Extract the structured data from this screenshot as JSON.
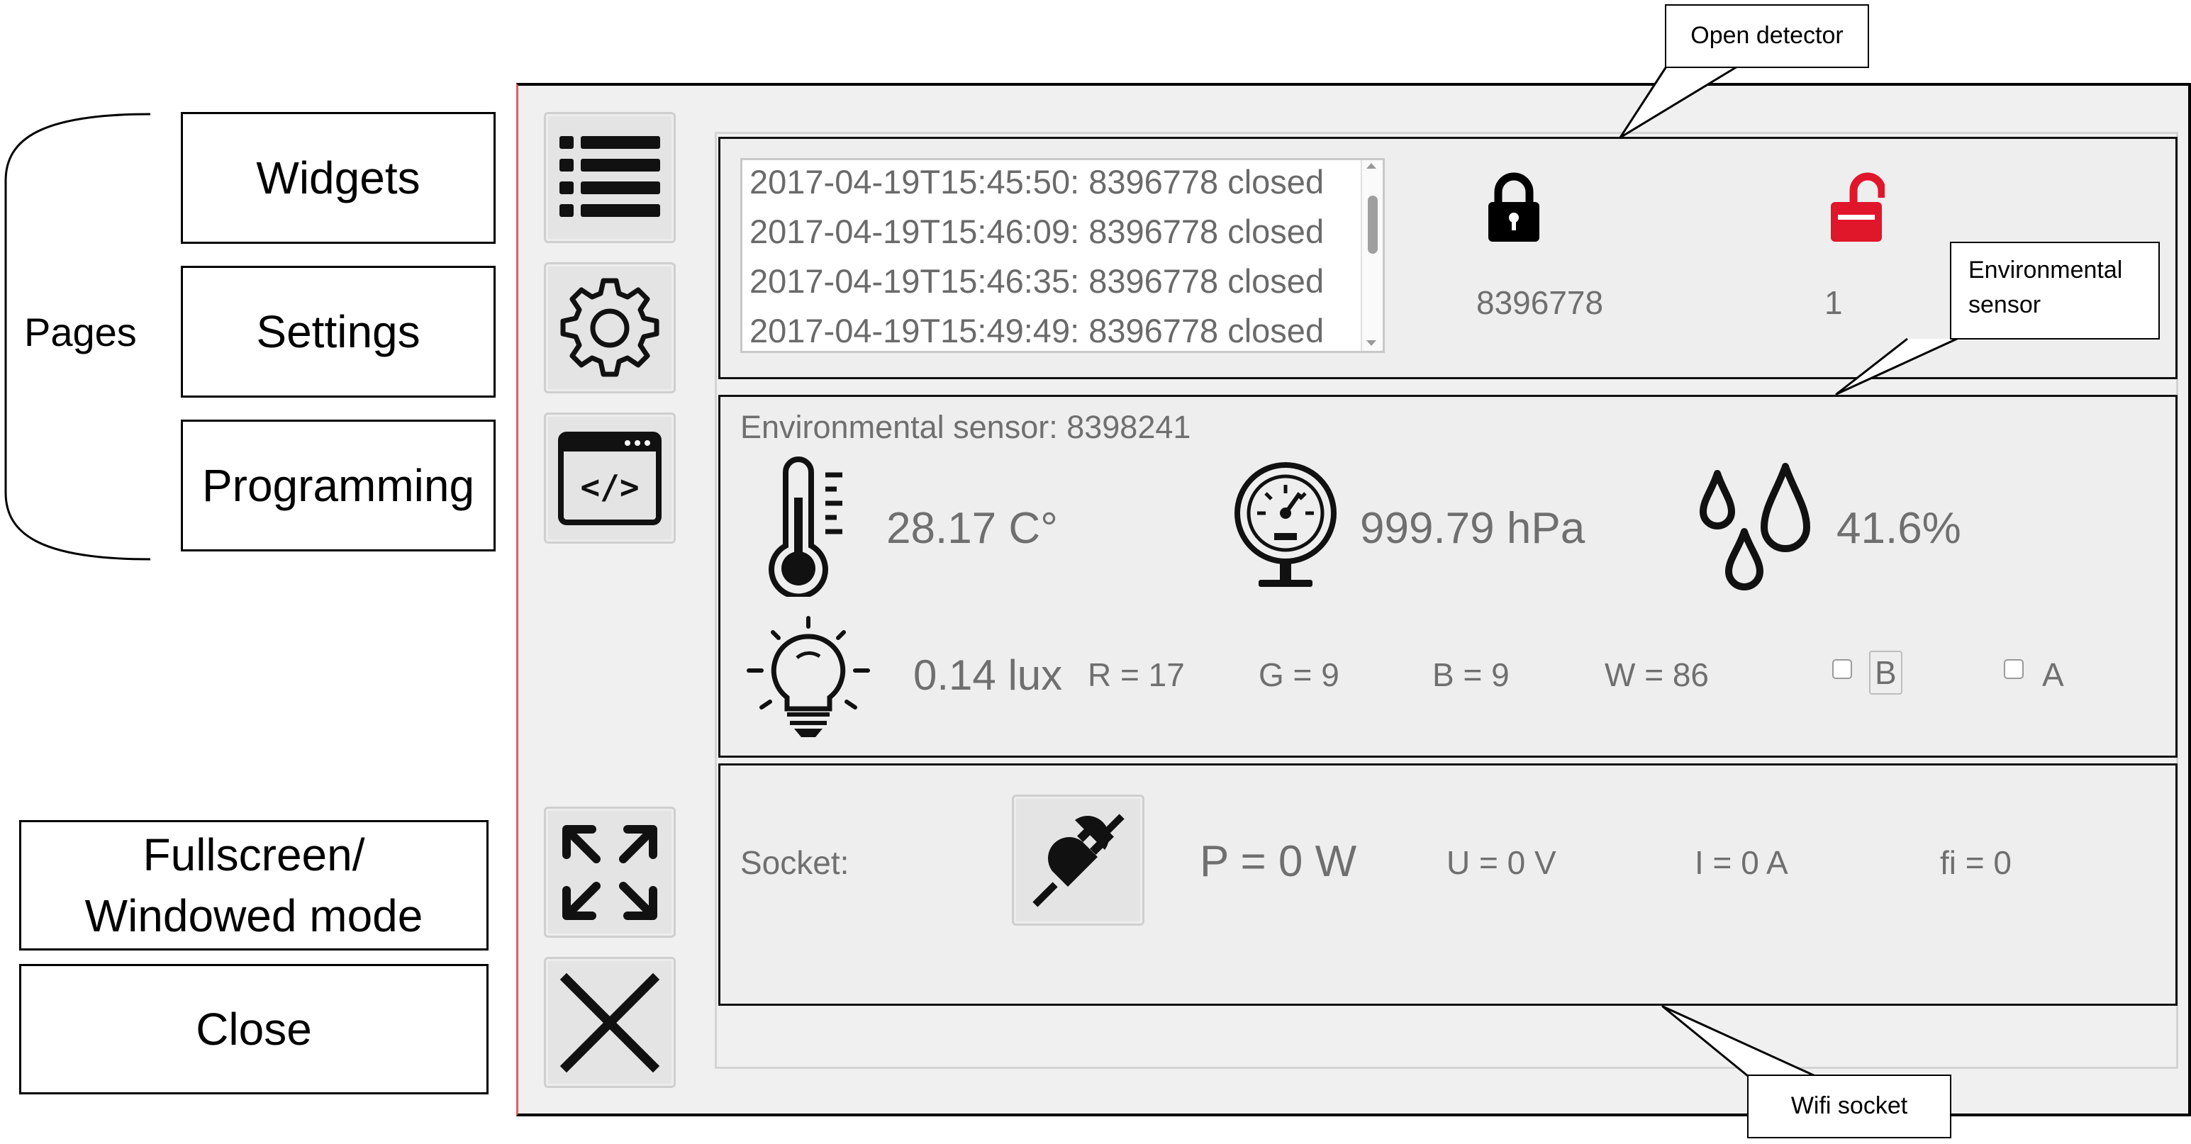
{
  "labels": {
    "pages": "Pages",
    "widgets": "Widgets",
    "settings": "Settings",
    "programming": "Programming",
    "fullscreen_line1": "Fullscreen/",
    "fullscreen_line2": "Windowed mode",
    "close": "Close"
  },
  "callouts": {
    "open_detector": "Open detector",
    "environmental_line1": "Environmental",
    "environmental_line2": "sensor",
    "wifi_socket": "Wifi socket"
  },
  "sidebar": {
    "icons": [
      "list-icon",
      "gear-icon",
      "code-window-icon",
      "expand-icon",
      "close-icon"
    ]
  },
  "open_detector": {
    "log": [
      "2017-04-19T15:45:50: 8396778 closed",
      "2017-04-19T15:46:09: 8396778 closed",
      "2017-04-19T15:46:35: 8396778 closed",
      "2017-04-19T15:49:49: 8396778 closed"
    ],
    "locked_id": "8396778",
    "unlocked_count": "1",
    "locked_color": "#000000",
    "unlocked_color": "#e0162b"
  },
  "environment": {
    "title": "Environmental sensor: 8398241",
    "temperature": "28.17 C°",
    "pressure": "999.79 hPa",
    "humidity": "41.6%",
    "lux": "0.14 lux",
    "r": "R = 17",
    "g": "G = 9",
    "b": "B = 9",
    "w": "W = 86",
    "checkbox_b": "B",
    "checkbox_a": "A"
  },
  "socket": {
    "label": "Socket:",
    "power": "P = 0 W",
    "voltage": "U = 0 V",
    "current": "I = 0 A",
    "fi": "fi = 0"
  }
}
